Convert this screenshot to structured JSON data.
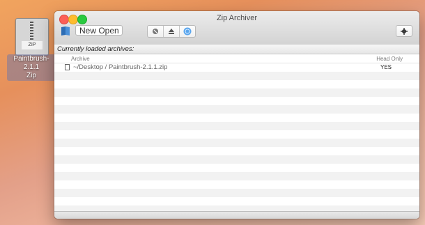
{
  "desktop": {
    "file_icon_label": "ZIP",
    "file_name_line1": "Paintbrush-2.1.1",
    "file_name_line2": "Zip"
  },
  "window": {
    "title": "Zip Archiver",
    "open_button_label": "New Open",
    "header_label": "Currently loaded archives:",
    "columns": {
      "archive": "Archive",
      "head_only": "Head Only"
    },
    "rows": [
      {
        "path": "~/Desktop / Paintbrush-2.1.1.zip",
        "head_only": "YES"
      }
    ],
    "toolbar_icons": [
      "book-icon",
      "stop-icon",
      "eject-icon",
      "globe-icon",
      "gear-icon"
    ]
  }
}
